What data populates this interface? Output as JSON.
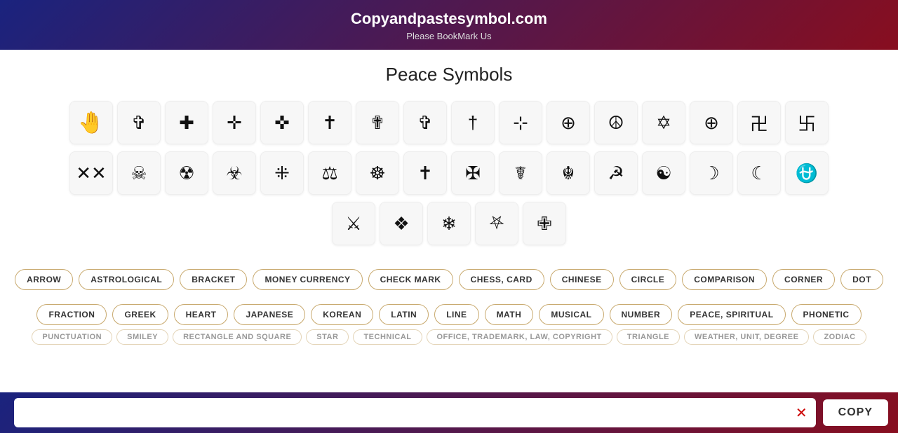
{
  "header": {
    "title": "Copyandpastesymbol.com",
    "subtitle": "Please BookMark Us"
  },
  "page": {
    "title": "Peace Symbols"
  },
  "symbols": {
    "row1": [
      {
        "char": "🤚",
        "label": "raised back of hand",
        "emoji": true
      },
      {
        "char": "✞",
        "label": "outlined latin cross"
      },
      {
        "char": "✚",
        "label": "heavy greek cross"
      },
      {
        "char": "✛",
        "label": "open centre cross"
      },
      {
        "char": "✜",
        "label": "heavy open centre cross"
      },
      {
        "char": "✝",
        "label": "latin cross"
      },
      {
        "char": "✟",
        "label": "outlined latin cross 2"
      },
      {
        "char": "✞",
        "label": "heavy latin cross"
      },
      {
        "char": "†",
        "label": "dagger"
      },
      {
        "char": "⊹",
        "label": "multiplication sign in circle"
      },
      {
        "char": "⊕",
        "label": "circled plus"
      },
      {
        "char": "☮",
        "label": "peace symbol"
      },
      {
        "char": "✡",
        "label": "star of david"
      },
      {
        "char": "⊕",
        "label": "circled plus 2"
      },
      {
        "char": "卍",
        "label": "manji"
      },
      {
        "char": "卐",
        "label": "swastika"
      }
    ],
    "row2": [
      {
        "char": "✕✕",
        "label": "double x"
      },
      {
        "char": "☠",
        "label": "skull and crossbones"
      },
      {
        "char": "☢",
        "label": "radioactive"
      },
      {
        "char": "☣",
        "label": "biohazard"
      },
      {
        "char": "⁜",
        "label": "dotted cross"
      },
      {
        "char": "⚖",
        "label": "scales"
      },
      {
        "char": "☸",
        "label": "dharma wheel"
      },
      {
        "char": "✝",
        "label": "latin cross 2"
      },
      {
        "char": "✠",
        "label": "maltese cross"
      },
      {
        "char": "☤",
        "label": "caduceus"
      },
      {
        "char": "☬",
        "label": "adi shakti"
      },
      {
        "char": "☭",
        "label": "hammer and sickle"
      },
      {
        "char": "☯",
        "label": "yin yang"
      },
      {
        "char": "☽",
        "label": "crescent moon"
      },
      {
        "char": "☾",
        "label": "last quarter moon"
      },
      {
        "char": "⛎",
        "label": "ophiuchus"
      }
    ],
    "row3": [
      {
        "char": "⚔",
        "label": "crossed swords"
      },
      {
        "char": "❖",
        "label": "black diamond minus"
      },
      {
        "char": "❄",
        "label": "snowflake"
      },
      {
        "char": "⛧",
        "label": "pentagram"
      },
      {
        "char": "✙",
        "label": "outlined greek cross"
      }
    ]
  },
  "categories": {
    "row1": [
      "ARROW",
      "ASTROLOGICAL",
      "BRACKET",
      "MONEY CURRENCY",
      "CHECK MARK",
      "CHESS, CARD",
      "CHINESE",
      "CIRCLE",
      "COMPARISON",
      "CORNER",
      "DOT"
    ],
    "row2": [
      "FRACTION",
      "GREEK",
      "HEART",
      "JAPANESE",
      "KOREAN",
      "LATIN",
      "LINE",
      "MATH",
      "MUSICAL",
      "NUMBER",
      "PEACE, SPIRITUAL",
      "PHONETIC"
    ],
    "row3": [
      "PUNCTUATION",
      "SMILEY",
      "RECTANGLE AND SQUARE",
      "STAR",
      "TECHNICAL",
      "OFFICE, TRADEMARK, LAW, COPYRIGHT",
      "TRIANGLE",
      "WEATHER, UNIT, DEGREE",
      "ZODIAC"
    ]
  },
  "search": {
    "placeholder": "",
    "copy_label": "COPY",
    "clear_label": "✕"
  }
}
